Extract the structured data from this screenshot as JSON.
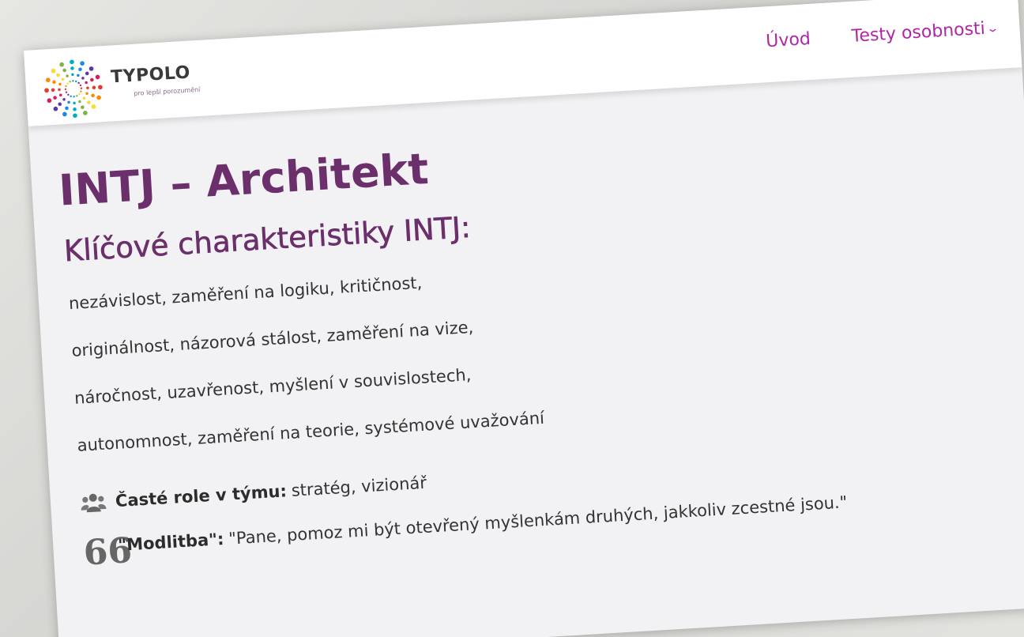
{
  "brand": {
    "name": "TYPOLO",
    "tagline": "pro lepší porozumění",
    "logo_icon": "dotted-sunburst-logo"
  },
  "nav": {
    "items": [
      {
        "label": "Úvod"
      },
      {
        "label": "Testy osobnosti",
        "dropdown": true,
        "chevron": "⌄"
      }
    ],
    "link_color": "#b026a6"
  },
  "page": {
    "title": "INTJ – Architekt",
    "subtitle": "Klíčové charakteristiky INTJ:",
    "title_color": "#6b2f6b",
    "traits": [
      "nezávislost, zaměření na logiku, kritičnost,",
      "originálnost, názorová stálost, zaměření na vize,",
      "náročnost, uzavřenost, myšlení v souvislostech,",
      "autonomnost, zaměření na teorie, systémové uvažování"
    ],
    "roles": {
      "icon": "users-icon",
      "label": "Časté role v týmu:",
      "value": "stratég, vizionář"
    },
    "prayer": {
      "icon": "quote-icon",
      "glyph": "66",
      "label": "\"Modlitba\":",
      "value": "\"Pane, pomoz mi být otevřený myšlenkám druhých, jakkoliv zcestné jsou.\""
    }
  }
}
